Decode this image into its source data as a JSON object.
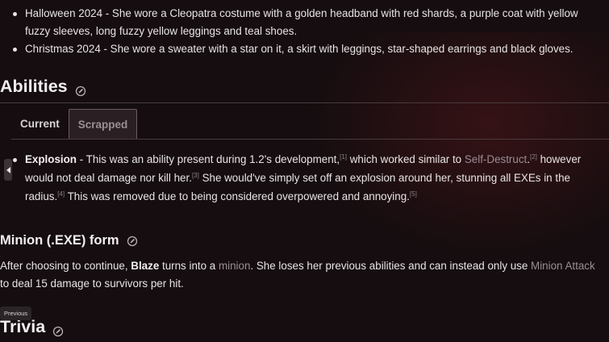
{
  "outfits": [
    "Halloween 2024 - She wore a Cleopatra costume with a golden headband with red shards, a purple coat with yellow fuzzy sleeves, long fuzzy yellow leggings and teal shoes.",
    "Christmas 2024 - She wore a sweater with a star on it, a skirt with leggings, star-shaped earrings and black gloves."
  ],
  "abilities": {
    "heading": "Abilities",
    "tabs": [
      "Current",
      "Scrapped"
    ],
    "active_tab": "Scrapped",
    "scrapped": {
      "name": "Explosion",
      "p1": " - This was an ability present during 1.2's development,",
      "ref1": "[1]",
      "p2": " which worked similar to ",
      "link": "Self-Destruct",
      "p3": ".",
      "ref2": "[2]",
      "p4": " however would not deal damage nor kill her.",
      "ref3": "[3]",
      "p5": " She would've simply set off an explosion around her, stunning all EXEs in the radius.",
      "ref4": "[4]",
      "p6": " This was removed due to being considered overpowered and annoying.",
      "ref5": "[5]"
    }
  },
  "minion": {
    "heading": "Minion (.EXE) form",
    "t1": "After choosing to continue, ",
    "name": "Blaze",
    "t2": " turns into a ",
    "link1": "minion",
    "t3": ". She loses her previous abilities and can instead only use ",
    "link2": "Minion Attack",
    "t4": " to deal 15 damage to survivors per hit."
  },
  "tooltip": "Previous",
  "trivia": {
    "heading": "Trivia"
  },
  "icons": [
    "pencil-edit-icon",
    "chevron-left-icon"
  ]
}
